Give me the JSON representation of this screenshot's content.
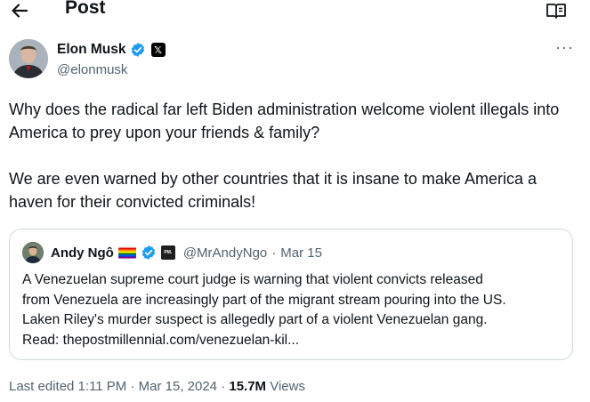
{
  "header": {
    "title": "Post"
  },
  "author": {
    "name": "Elon Musk",
    "handle": "@elonmusk",
    "more": "···"
  },
  "tweet": {
    "paragraph1": "Why does the radical far left Biden administration welcome violent illegals into America to prey upon your friends & family?",
    "paragraph2": "We are even warned by other countries that it is insane to make America a haven for their convicted criminals!"
  },
  "quote": {
    "name": "Andy Ngô",
    "badge_text": "PM.",
    "handle": "@MrAndyNgo",
    "separator": "·",
    "date": "Mar 15",
    "lines": [
      "A Venezuelan supreme court judge is warning that violent convicts released",
      "from Venezuela are increasingly part of the migrant stream pouring into the US.",
      "Laken Riley's murder suspect is allegedly part of a violent Venezuelan gang.",
      "Read:  thepostmillennial.com/venezuelan-kil..."
    ]
  },
  "meta": {
    "edited": "Last edited 1:11 PM · Mar 15, 2024 · ",
    "views_count": "15.7M",
    "views_label": " Views"
  },
  "icons": {
    "back": "arrow-left-icon",
    "reader": "reader-icon",
    "verified": "verified-badge-icon",
    "affiliate": "x-logo-icon",
    "flag": "rainbow-flag-icon"
  },
  "colors": {
    "verified_blue": "#1d9bf0",
    "secondary_text": "#536471",
    "border": "#cfd9de"
  }
}
